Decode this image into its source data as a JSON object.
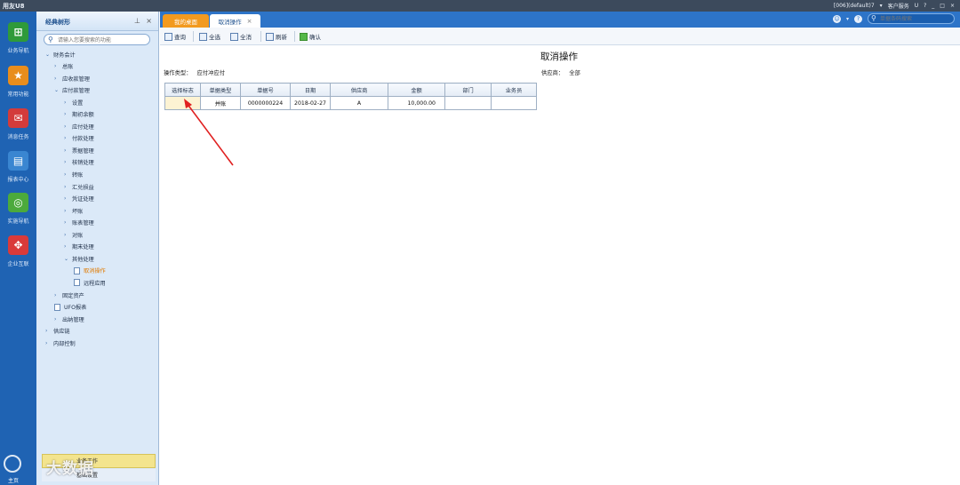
{
  "app": {
    "logo": "用友U8",
    "right_info": "[006](default)7",
    "customer_service": "客户服务",
    "window_icons": [
      "U",
      "?",
      "_",
      "□",
      "×"
    ]
  },
  "rail": {
    "items": [
      {
        "label": "业务导航",
        "icon": "business-nav-icon",
        "color": "#2f9a3a"
      },
      {
        "label": "常用功能",
        "icon": "star-icon",
        "color": "#e88d1c"
      },
      {
        "label": "消息任务",
        "icon": "message-icon",
        "color": "#d33b3b"
      },
      {
        "label": "报表中心",
        "icon": "report-icon",
        "color": "#3a86d1"
      },
      {
        "label": "实施导航",
        "icon": "compass-icon",
        "color": "#4caa3c"
      },
      {
        "label": "企业互联",
        "icon": "link-icon",
        "color": "#d93a3a"
      }
    ],
    "home_label": "主页"
  },
  "tree": {
    "title": "经典树形",
    "search_placeholder": "请输入您要搜索的功能",
    "nodes": [
      {
        "label": "财务会计",
        "level": 0,
        "expanded": true
      },
      {
        "label": "总账",
        "level": 1,
        "expanded": false
      },
      {
        "label": "应收款管理",
        "level": 1,
        "expanded": false
      },
      {
        "label": "应付款管理",
        "level": 1,
        "expanded": true
      },
      {
        "label": "设置",
        "level": 2,
        "expanded": false
      },
      {
        "label": "期初余额",
        "level": 2,
        "expanded": false
      },
      {
        "label": "应付处理",
        "level": 2,
        "expanded": false
      },
      {
        "label": "付款处理",
        "level": 2,
        "expanded": false
      },
      {
        "label": "票据管理",
        "level": 2,
        "expanded": false
      },
      {
        "label": "核销处理",
        "level": 2,
        "expanded": false
      },
      {
        "label": "转账",
        "level": 2,
        "expanded": false
      },
      {
        "label": "汇兑损益",
        "level": 2,
        "expanded": false
      },
      {
        "label": "凭证处理",
        "level": 2,
        "expanded": false
      },
      {
        "label": "坏账",
        "level": 2,
        "expanded": false
      },
      {
        "label": "账表管理",
        "level": 2,
        "expanded": false
      },
      {
        "label": "对账",
        "level": 2,
        "expanded": false
      },
      {
        "label": "期末处理",
        "level": 2,
        "expanded": false
      },
      {
        "label": "其他处理",
        "level": 2,
        "expanded": true
      },
      {
        "label": "取消操作",
        "level": 3,
        "leaf": true,
        "active": true
      },
      {
        "label": "远程应用",
        "level": 3,
        "leaf": true
      },
      {
        "label": "固定资产",
        "level": 1,
        "expanded": false
      },
      {
        "label": "UFO报表",
        "level": 1,
        "leaf": true
      },
      {
        "label": "出纳管理",
        "level": 1,
        "expanded": false
      },
      {
        "label": "供应链",
        "level": 0,
        "expanded": false
      },
      {
        "label": "内部控制",
        "level": 0,
        "expanded": false
      }
    ],
    "bottom_item1": "业务工作",
    "bottom_item2": "基础设置",
    "watermark": "大数据"
  },
  "tabs": {
    "home": "我的桌面",
    "current": "取消操作",
    "menu_search_placeholder": "单据条码搜索"
  },
  "toolbar": {
    "query": "查询",
    "select_all": "全选",
    "deselect_all": "全消",
    "refresh": "刷新",
    "confirm": "确认"
  },
  "page": {
    "title": "取消操作",
    "op_type_label": "操作类型：",
    "op_type_value": "应付冲应付",
    "supplier_label": "供应商：",
    "supplier_value": "全部"
  },
  "table": {
    "columns": [
      "选择标志",
      "单据类型",
      "单据号",
      "日期",
      "供应商",
      "金额",
      "部门",
      "业务员"
    ],
    "rows": [
      [
        "",
        "并账",
        "0000000224",
        "2018-02-27",
        "A",
        "10,000.00",
        "",
        ""
      ]
    ]
  },
  "colors": {
    "accent": "#2d74c8",
    "home_tab": "#f29a1f",
    "rail": "#1f63b3",
    "annotation_arrow": "#e02020"
  }
}
